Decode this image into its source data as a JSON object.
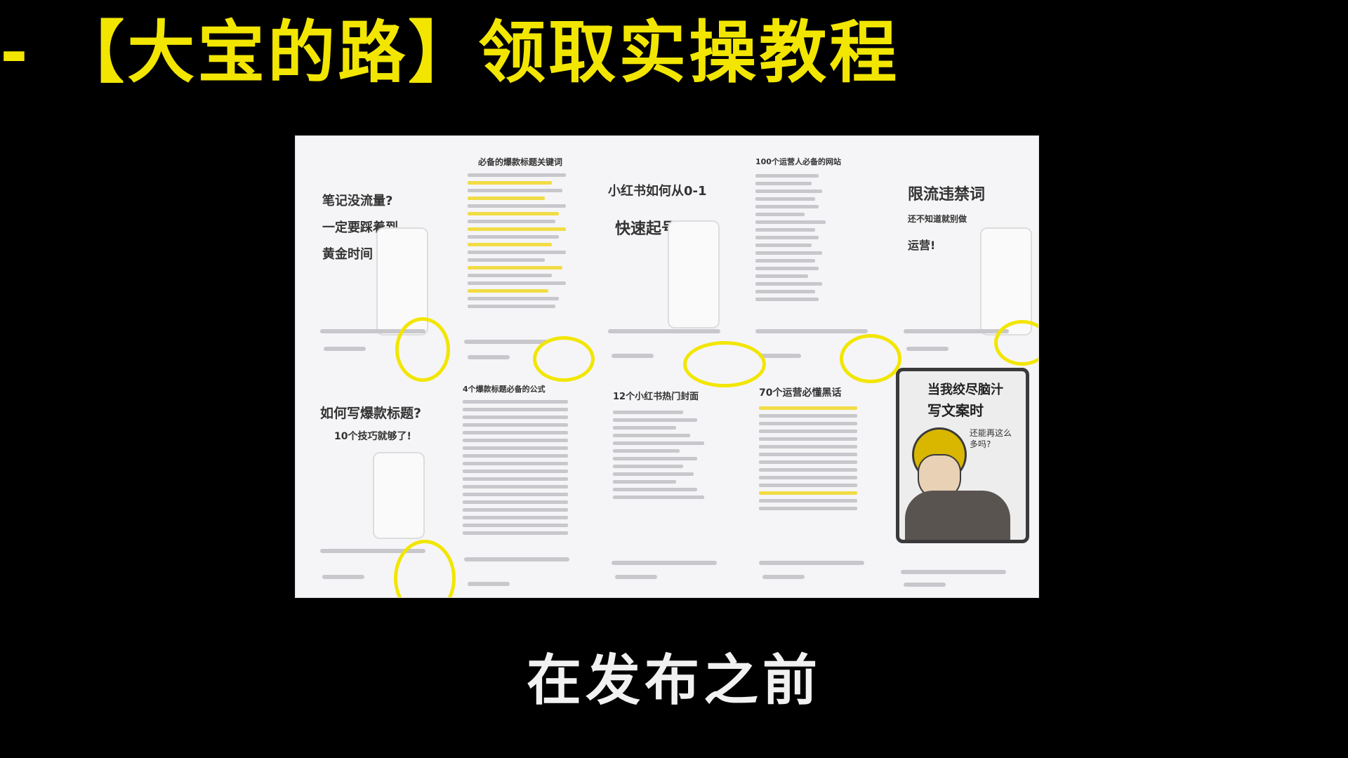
{
  "banner": {
    "text": "- 【大宝的路】领取实操教程"
  },
  "subtitle": {
    "text": "在发布之前"
  },
  "screen": {
    "cards": [
      {
        "title": "笔记没流量?"
      },
      {
        "title": "一定要踩着到"
      },
      {
        "title": "黄金时间"
      },
      {
        "title": "必备的爆款标题关键词"
      },
      {
        "title": "小红书如何从0-1"
      },
      {
        "title": "快速起号"
      },
      {
        "title": "100个运营人必备的网站"
      },
      {
        "title": "限流违禁词"
      },
      {
        "title": "还不知道就别做"
      },
      {
        "title": "运营!"
      },
      {
        "title": "如何写爆款标题?"
      },
      {
        "title": "10个技巧就够了!"
      },
      {
        "title": "4个爆款标题必备的公式"
      },
      {
        "title": "12个小红书热门封面"
      },
      {
        "title": "70个运营必懂黑话"
      }
    ],
    "poster": {
      "line1": "当我绞尽脑汁",
      "line2": "写文案时",
      "line3": "还能再这么多吗?"
    }
  },
  "colors": {
    "accent": "#f2e600",
    "background": "#000000",
    "screen": "#f5f5f7"
  }
}
